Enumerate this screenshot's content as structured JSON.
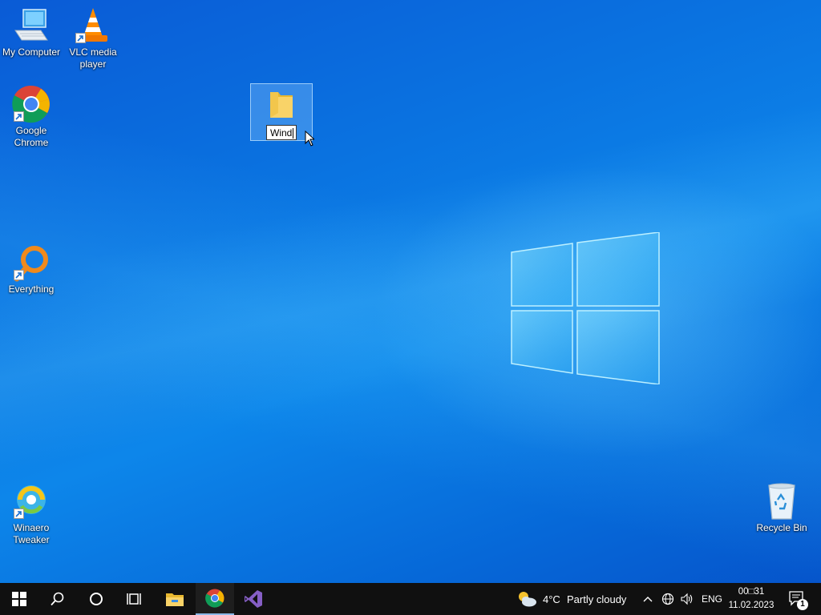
{
  "desktop": {
    "icons": [
      {
        "label_line1": "My Computer",
        "label_line2": ""
      },
      {
        "label_line1": "VLC media",
        "label_line2": "player"
      },
      {
        "label_line1": "Google",
        "label_line2": "Chrome"
      },
      {
        "label_line1": "Everything",
        "label_line2": ""
      },
      {
        "label_line1": "Winaero",
        "label_line2": "Tweaker"
      },
      {
        "label_line1": "Recycle Bin",
        "label_line2": ""
      }
    ],
    "renaming_folder": {
      "name_value": "Wind"
    }
  },
  "taskbar": {
    "weather": {
      "temperature": "4°C",
      "condition": "Partly cloudy"
    },
    "language": "ENG",
    "clock": {
      "time": "00□31",
      "date": "11.02.2023"
    },
    "notification_count": "1"
  },
  "colors": {
    "taskbar_bg": "#101010",
    "desktop_blue": "#0a72e0",
    "selection": "#8cc8ff"
  }
}
